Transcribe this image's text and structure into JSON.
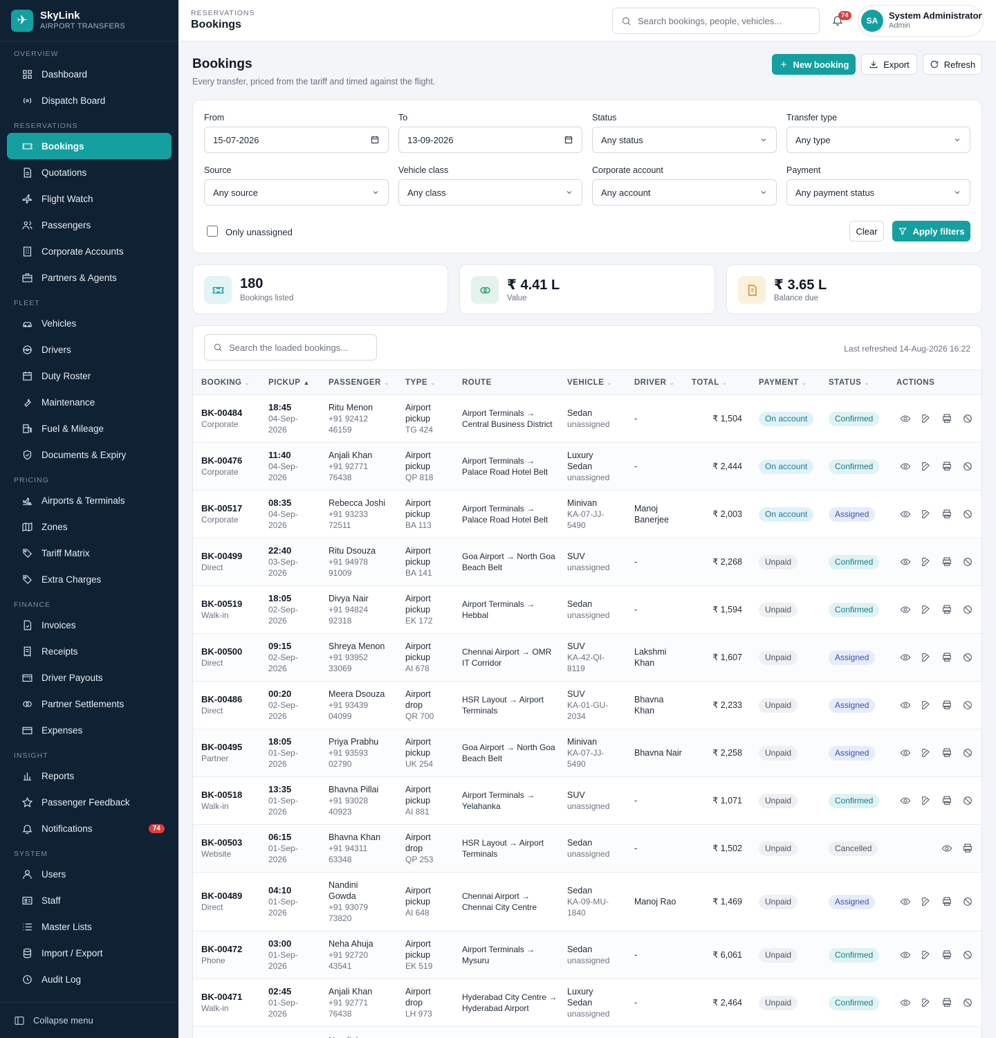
{
  "brand": {
    "name": "SkyLink",
    "sub": "AIRPORT TRANSFERS"
  },
  "sidebar": {
    "sections": [
      {
        "title": "OVERVIEW",
        "items": [
          {
            "label": "Dashboard",
            "icon": "grid-icon"
          },
          {
            "label": "Dispatch Board",
            "icon": "radio-icon"
          }
        ]
      },
      {
        "title": "RESERVATIONS",
        "items": [
          {
            "label": "Bookings",
            "icon": "ticket-icon",
            "active": true
          },
          {
            "label": "Quotations",
            "icon": "document-icon"
          },
          {
            "label": "Flight Watch",
            "icon": "plane-icon"
          },
          {
            "label": "Passengers",
            "icon": "users-icon"
          },
          {
            "label": "Corporate Accounts",
            "icon": "building-icon"
          },
          {
            "label": "Partners & Agents",
            "icon": "briefcase-icon"
          }
        ]
      },
      {
        "title": "FLEET",
        "items": [
          {
            "label": "Vehicles",
            "icon": "car-icon"
          },
          {
            "label": "Drivers",
            "icon": "driver-icon"
          },
          {
            "label": "Duty Roster",
            "icon": "calendar-icon"
          },
          {
            "label": "Maintenance",
            "icon": "wrench-icon"
          },
          {
            "label": "Fuel & Mileage",
            "icon": "fuel-icon"
          },
          {
            "label": "Documents & Expiry",
            "icon": "shield-icon"
          }
        ]
      },
      {
        "title": "PRICING",
        "items": [
          {
            "label": "Airports & Terminals",
            "icon": "plane-landing-icon"
          },
          {
            "label": "Zones",
            "icon": "map-icon"
          },
          {
            "label": "Tariff Matrix",
            "icon": "tag-icon"
          },
          {
            "label": "Extra Charges",
            "icon": "tag-icon"
          }
        ]
      },
      {
        "title": "FINANCE",
        "items": [
          {
            "label": "Invoices",
            "icon": "invoice-icon"
          },
          {
            "label": "Receipts",
            "icon": "receipt-icon"
          },
          {
            "label": "Driver Payouts",
            "icon": "wallet-icon"
          },
          {
            "label": "Partner Settlements",
            "icon": "handshake-icon"
          },
          {
            "label": "Expenses",
            "icon": "card-icon"
          }
        ]
      },
      {
        "title": "INSIGHT",
        "items": [
          {
            "label": "Reports",
            "icon": "bar-chart-icon"
          },
          {
            "label": "Passenger Feedback",
            "icon": "star-icon"
          },
          {
            "label": "Notifications",
            "icon": "bell-icon",
            "badge": "74"
          }
        ]
      },
      {
        "title": "SYSTEM",
        "items": [
          {
            "label": "Users",
            "icon": "user-icon"
          },
          {
            "label": "Staff",
            "icon": "id-card-icon"
          },
          {
            "label": "Master Lists",
            "icon": "list-icon"
          },
          {
            "label": "Import / Export",
            "icon": "database-icon"
          },
          {
            "label": "Audit Log",
            "icon": "clock-icon"
          }
        ]
      }
    ],
    "collapse": "Collapse menu"
  },
  "topbar": {
    "crumb": "RESERVATIONS",
    "title": "Bookings",
    "search_placeholder": "Search bookings, people, vehicles...",
    "notif_count": "74",
    "user_initials": "SA",
    "user_name": "System Administrator",
    "user_role": "Admin"
  },
  "page": {
    "title": "Bookings",
    "subtitle": "Every transfer, priced from the tariff and timed against the flight.",
    "new_booking": "New booking",
    "export": "Export",
    "refresh": "Refresh"
  },
  "filters": {
    "from_label": "From",
    "from_value": "15-07-2026",
    "to_label": "To",
    "to_value": "13-09-2026",
    "status_label": "Status",
    "status_value": "Any status",
    "type_label": "Transfer type",
    "type_value": "Any type",
    "source_label": "Source",
    "source_value": "Any source",
    "vclass_label": "Vehicle class",
    "vclass_value": "Any class",
    "corp_label": "Corporate account",
    "corp_value": "Any account",
    "payment_label": "Payment",
    "payment_value": "Any payment status",
    "unassigned_label": "Only unassigned",
    "clear": "Clear",
    "apply": "Apply filters"
  },
  "stats": [
    {
      "value": "180",
      "label": "Bookings listed",
      "icon": "ticket-icon",
      "color": "#14a0a0",
      "bg": "#e2f4f4"
    },
    {
      "value": "₹ 4.41 L",
      "label": "Value",
      "icon": "coins-icon",
      "color": "#1e9a6a",
      "bg": "#e3f3ec"
    },
    {
      "value": "₹ 3.65 L",
      "label": "Balance due",
      "icon": "file-invoice-icon",
      "color": "#c98a16",
      "bg": "#fbf0dc"
    }
  ],
  "table": {
    "search_placeholder": "Search the loaded bookings...",
    "refreshed": "Last refreshed 14-Aug-2026 16:22",
    "headers": {
      "booking": "BOOKING",
      "pickup": "PICKUP",
      "passenger": "PASSENGER",
      "type": "TYPE",
      "route": "ROUTE",
      "vehicle": "VEHICLE",
      "driver": "DRIVER",
      "total": "TOTAL",
      "payment": "PAYMENT",
      "status": "STATUS",
      "actions": "ACTIONS"
    },
    "rows": [
      {
        "id": "BK-00484",
        "source": "Corporate",
        "time": "18:45",
        "date": "04-Sep-2026",
        "pax": "Ritu Menon",
        "phone": "+91 92412 46159",
        "type": "Airport pickup",
        "flight": "TG 424",
        "route": "Airport Terminals → Central Business District",
        "vehicle": "Sedan",
        "plate": "unassigned",
        "driver": "-",
        "total": "₹ 1,504",
        "payment": "On account",
        "status": "Confirmed"
      },
      {
        "id": "BK-00476",
        "source": "Corporate",
        "time": "11:40",
        "date": "04-Sep-2026",
        "pax": "Anjali Khan",
        "phone": "+91 92771 76438",
        "type": "Airport pickup",
        "flight": "QP 818",
        "route": "Airport Terminals → Palace Road Hotel Belt",
        "vehicle": "Luxury Sedan",
        "plate": "unassigned",
        "driver": "-",
        "total": "₹ 2,444",
        "payment": "On account",
        "status": "Confirmed"
      },
      {
        "id": "BK-00517",
        "source": "Corporate",
        "time": "08:35",
        "date": "04-Sep-2026",
        "pax": "Rebecca Joshi",
        "phone": "+91 93233 72511",
        "type": "Airport pickup",
        "flight": "BA 113",
        "route": "Airport Terminals → Palace Road Hotel Belt",
        "vehicle": "Minivan",
        "plate": "KA-07-JJ-5490",
        "driver": "Manoj Banerjee",
        "total": "₹ 2,003",
        "payment": "On account",
        "status": "Assigned"
      },
      {
        "id": "BK-00499",
        "source": "Direct",
        "time": "22:40",
        "date": "03-Sep-2026",
        "pax": "Ritu Dsouza",
        "phone": "+91 94978 91009",
        "type": "Airport pickup",
        "flight": "BA 141",
        "route": "Goa Airport → North Goa Beach Belt",
        "vehicle": "SUV",
        "plate": "unassigned",
        "driver": "-",
        "total": "₹ 2,268",
        "payment": "Unpaid",
        "status": "Confirmed"
      },
      {
        "id": "BK-00519",
        "source": "Walk-in",
        "time": "18:05",
        "date": "02-Sep-2026",
        "pax": "Divya Nair",
        "phone": "+91 94824 92318",
        "type": "Airport pickup",
        "flight": "EK 172",
        "route": "Airport Terminals → Hebbal",
        "vehicle": "Sedan",
        "plate": "unassigned",
        "driver": "-",
        "total": "₹ 1,594",
        "payment": "Unpaid",
        "status": "Confirmed"
      },
      {
        "id": "BK-00500",
        "source": "Direct",
        "time": "09:15",
        "date": "02-Sep-2026",
        "pax": "Shreya Menon",
        "phone": "+91 93952 33069",
        "type": "Airport pickup",
        "flight": "AI 678",
        "route": "Chennai Airport → OMR IT Corridor",
        "vehicle": "SUV",
        "plate": "KA-42-QI-8119",
        "driver": "Lakshmi Khan",
        "total": "₹ 1,607",
        "payment": "Unpaid",
        "status": "Assigned"
      },
      {
        "id": "BK-00486",
        "source": "Direct",
        "time": "00:20",
        "date": "02-Sep-2026",
        "pax": "Meera Dsouza",
        "phone": "+91 93439 04099",
        "type": "Airport drop",
        "flight": "QR 700",
        "route": "HSR Layout → Airport Terminals",
        "vehicle": "SUV",
        "plate": "KA-01-GU-2034",
        "driver": "Bhavna Khan",
        "total": "₹ 2,233",
        "payment": "Unpaid",
        "status": "Assigned"
      },
      {
        "id": "BK-00495",
        "source": "Partner",
        "time": "18:05",
        "date": "01-Sep-2026",
        "pax": "Priya Prabhu",
        "phone": "+91 93593 02790",
        "type": "Airport pickup",
        "flight": "UK 254",
        "route": "Goa Airport → North Goa Beach Belt",
        "vehicle": "Minivan",
        "plate": "KA-07-JJ-5490",
        "driver": "Bhavna Nair",
        "total": "₹ 2,258",
        "payment": "Unpaid",
        "status": "Assigned"
      },
      {
        "id": "BK-00518",
        "source": "Walk-in",
        "time": "13:35",
        "date": "01-Sep-2026",
        "pax": "Bhavna Pillai",
        "phone": "+91 93028 40923",
        "type": "Airport pickup",
        "flight": "AI 881",
        "route": "Airport Terminals → Yelahanka",
        "vehicle": "SUV",
        "plate": "unassigned",
        "driver": "-",
        "total": "₹ 1,071",
        "payment": "Unpaid",
        "status": "Confirmed"
      },
      {
        "id": "BK-00503",
        "source": "Website",
        "time": "06:15",
        "date": "01-Sep-2026",
        "pax": "Bhavna Khan",
        "phone": "+91 94311 63348",
        "type": "Airport drop",
        "flight": "QP 253",
        "route": "HSR Layout → Airport Terminals",
        "vehicle": "Sedan",
        "plate": "unassigned",
        "driver": "-",
        "total": "₹ 1,502",
        "payment": "Unpaid",
        "status": "Cancelled"
      },
      {
        "id": "BK-00489",
        "source": "Direct",
        "time": "04:10",
        "date": "01-Sep-2026",
        "pax": "Nandini Gowda",
        "phone": "+91 93079 73820",
        "type": "Airport pickup",
        "flight": "AI 648",
        "route": "Chennai Airport → Chennai City Centre",
        "vehicle": "Sedan",
        "plate": "KA-09-MU-1840",
        "driver": "Manoj Rao",
        "total": "₹ 1,469",
        "payment": "Unpaid",
        "status": "Assigned"
      },
      {
        "id": "BK-00472",
        "source": "Phone",
        "time": "03:00",
        "date": "01-Sep-2026",
        "pax": "Neha Ahuja",
        "phone": "+91 92720 43541",
        "type": "Airport pickup",
        "flight": "EK 519",
        "route": "Airport Terminals → Mysuru",
        "vehicle": "Sedan",
        "plate": "unassigned",
        "driver": "-",
        "total": "₹ 6,061",
        "payment": "Unpaid",
        "status": "Confirmed"
      },
      {
        "id": "BK-00471",
        "source": "Walk-in",
        "time": "02:45",
        "date": "01-Sep-2026",
        "pax": "Anjali Khan",
        "phone": "+91 92771 76438",
        "type": "Airport drop",
        "flight": "LH 973",
        "route": "Hyderabad City Centre → Hyderabad Airport",
        "vehicle": "Luxury Sedan",
        "plate": "unassigned",
        "driver": "-",
        "total": "₹ 2,464",
        "payment": "Unpaid",
        "status": "Confirmed"
      },
      {
        "id": "",
        "source": "",
        "time": "",
        "date": "",
        "pax": "Nandini",
        "phone": "",
        "type": "",
        "flight": "",
        "route": "",
        "vehicle": "",
        "plate": "",
        "driver": "",
        "total": "",
        "payment": "",
        "status": ""
      }
    ]
  }
}
